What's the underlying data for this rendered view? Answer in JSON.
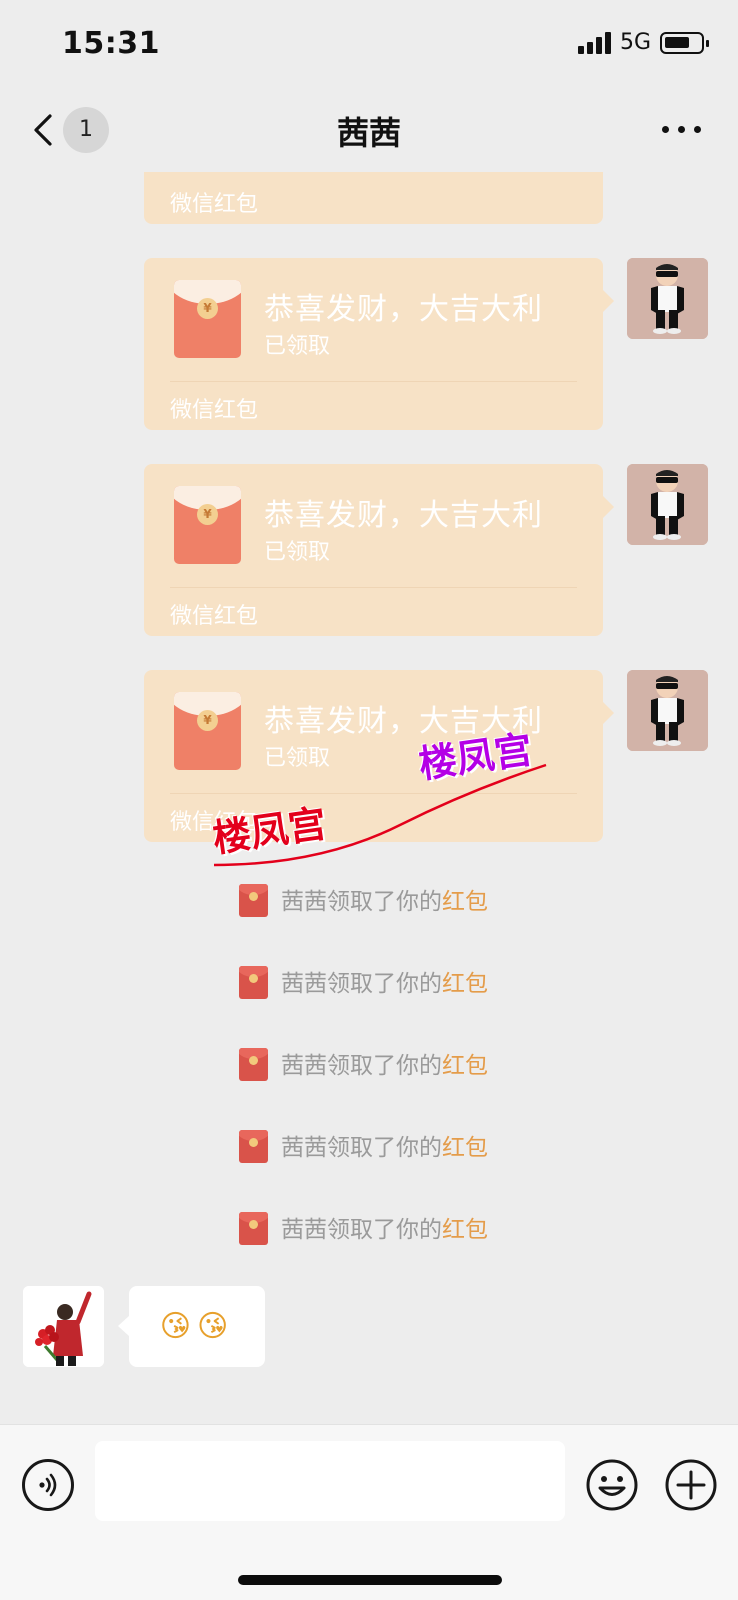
{
  "status_bar": {
    "time": "15:31",
    "network": "5G"
  },
  "nav": {
    "unread_count": "1",
    "title": "茜茜"
  },
  "red_packets": [
    {
      "footer": "微信红包"
    },
    {
      "title": "恭喜发财，大吉大利",
      "status": "已领取",
      "footer": "微信红包"
    },
    {
      "title": "恭喜发财，大吉大利",
      "status": "已领取",
      "footer": "微信红包"
    },
    {
      "title": "恭喜发财，大吉大利",
      "status": "已领取",
      "footer": "微信红包"
    }
  ],
  "system_notices": [
    {
      "text": "茜茜领取了你的",
      "link": "红包"
    },
    {
      "text": "茜茜领取了你的",
      "link": "红包"
    },
    {
      "text": "茜茜领取了你的",
      "link": "红包"
    },
    {
      "text": "茜茜领取了你的",
      "link": "红包"
    },
    {
      "text": "茜茜领取了你的",
      "link": "红包"
    }
  ],
  "incoming_message": {
    "text": "😘😘"
  },
  "watermarks": [
    {
      "text": "楼凤宫",
      "color": "#e3001b"
    },
    {
      "text": "楼凤宫",
      "color": "#b400e6"
    }
  ],
  "input": {
    "value": "",
    "placeholder": ""
  },
  "colors": {
    "red_packet_bg": "#f7e2c6",
    "envelope": "#ef8067",
    "link": "#e49c4a",
    "background": "#ededed"
  },
  "icons": {
    "back": "chevron-left-icon",
    "more": "ellipsis-icon",
    "voice": "voice-icon",
    "emoji": "smiley-icon",
    "plus": "plus-icon"
  }
}
